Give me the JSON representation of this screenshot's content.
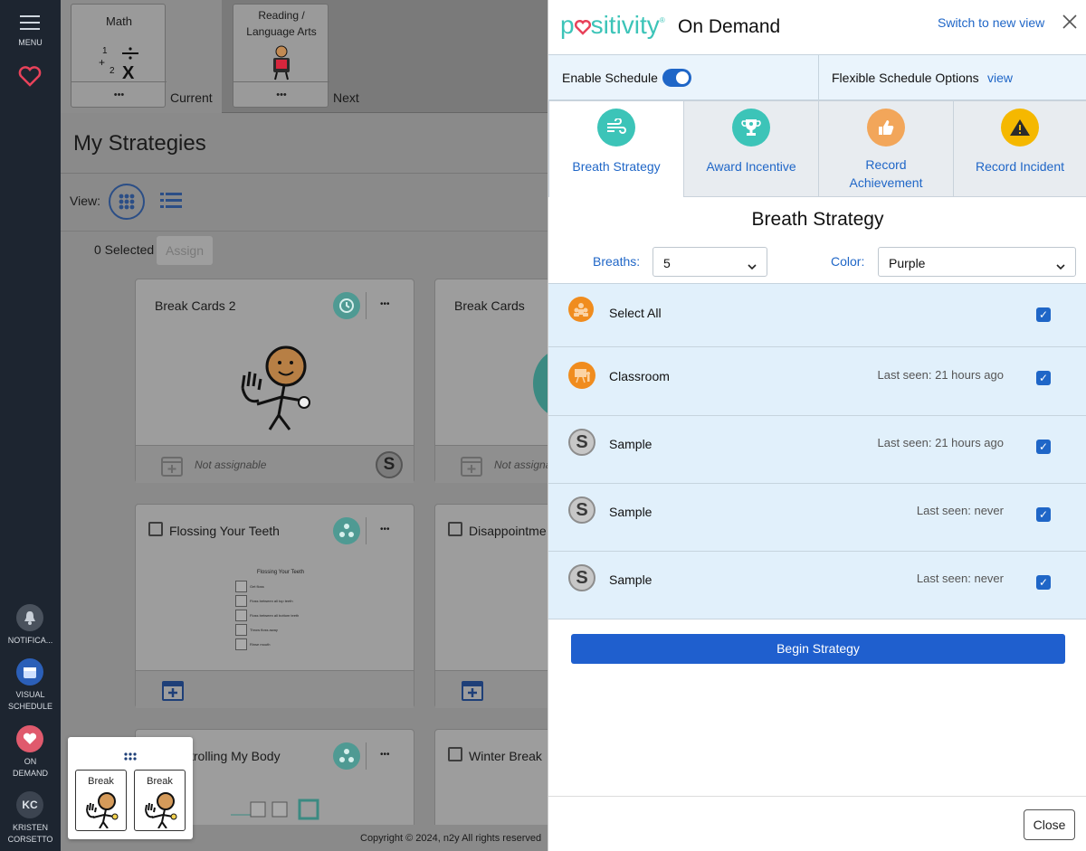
{
  "nav": {
    "menu_label": "MENU",
    "notifications_label": "NOTIFICA...",
    "visual_schedule_label": [
      "VISUAL",
      "SCHEDULE"
    ],
    "on_demand_label": [
      "ON",
      "DEMAND"
    ],
    "user_initials": "KC",
    "user_name": [
      "KRISTEN",
      "CORSETTO"
    ]
  },
  "schedule": {
    "current_title": "Math",
    "current_label": "Current",
    "next_title": "Reading / Language Arts",
    "next_label": "Next",
    "more": "•••"
  },
  "strategies": {
    "heading": "My Strategies",
    "view_label": "View:",
    "selected_text": "0 Selected",
    "assign_label": "Assign",
    "cards": [
      {
        "title": "Break Cards 2",
        "footer": "Not assignable"
      },
      {
        "title": "Break Cards",
        "footer": "Not assigna"
      },
      {
        "title": "Flossing Your Teeth"
      },
      {
        "title": "Disappointme"
      },
      {
        "title": "trolling My Body"
      },
      {
        "title": "Winter Break"
      }
    ],
    "floss_sheet": {
      "title": "Flossing Your Teeth",
      "steps": [
        "Get floss",
        "Floss between all top teeth",
        "Floss between all bottom teeth",
        "Throw floss away",
        "Rinse mouth"
      ]
    },
    "break_tiles": [
      "Break",
      "Break"
    ],
    "copyright": "Copyright © 2024, n2y All rights reserved"
  },
  "panel": {
    "brand": "psitivity",
    "brand_sub": "On Demand",
    "switch_link": "Switch to new view",
    "enable_label": "Enable Schedule",
    "flexible_label": "Flexible Schedule Options",
    "flexible_link": "view",
    "tabs": [
      {
        "label": "Breath Strategy",
        "icon": "wind-icon",
        "color": "#3cc4b8"
      },
      {
        "label": "Award Incentive",
        "icon": "trophy-icon",
        "color": "#3cc4b8"
      },
      {
        "label": "Record Achievement",
        "icon": "thumbs-up-icon",
        "color": "#f2a65a"
      },
      {
        "label": "Record Incident",
        "icon": "warning-icon",
        "color": "#f5b800"
      }
    ],
    "section_title": "Breath Strategy",
    "breaths_label": "Breaths:",
    "breaths_value": "5",
    "color_label": "Color:",
    "color_value": "Purple",
    "rows": [
      {
        "name": "Select All",
        "seen": ""
      },
      {
        "name": "Classroom",
        "seen": "Last seen: 21 hours ago"
      },
      {
        "name": "Sample",
        "seen": "Last seen: 21 hours ago"
      },
      {
        "name": "Sample",
        "seen": "Last seen: never"
      },
      {
        "name": "Sample",
        "seen": "Last seen: never"
      }
    ],
    "begin_label": "Begin Strategy",
    "close_label": "Close",
    "accent_color": "#1f66c7"
  }
}
